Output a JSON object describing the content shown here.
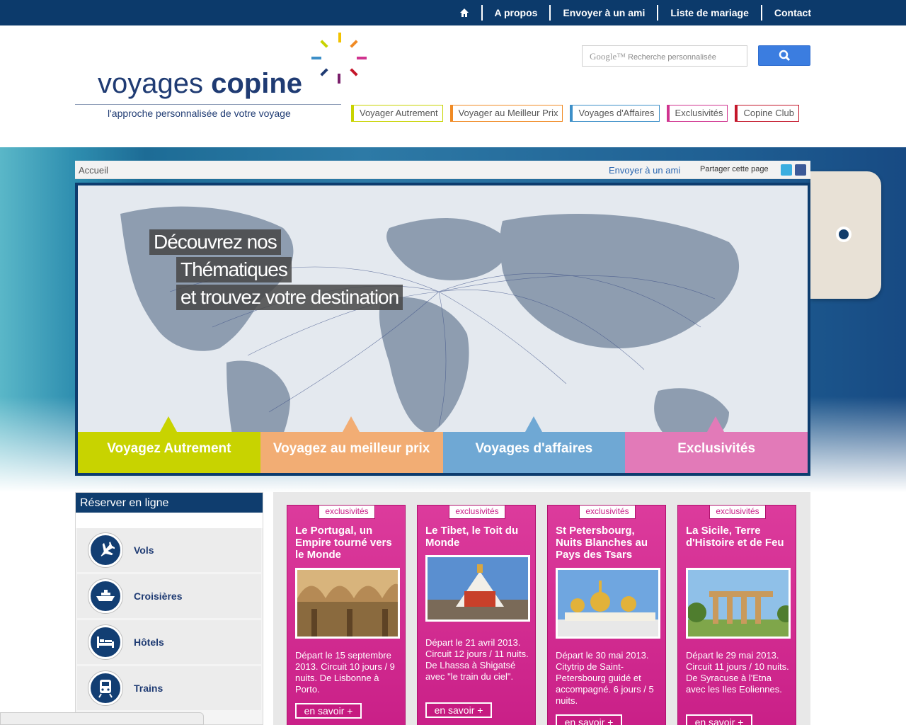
{
  "topnav": {
    "items": [
      "A propos",
      "Envoyer à un ami",
      "Liste de mariage",
      "Contact"
    ]
  },
  "logo": {
    "word1": "voyages",
    "word2": "copine",
    "tagline": "l'approche personnalisée de votre voyage"
  },
  "search": {
    "brand": "Google™",
    "placeholder": "Recherche personnalisée"
  },
  "themes": [
    {
      "label": "Voyager Autrement",
      "color": "#c8d300"
    },
    {
      "label": "Voyager au Meilleur Prix",
      "color": "#f08a24"
    },
    {
      "label": "Voyages d'Affaires",
      "color": "#3c8fc8"
    },
    {
      "label": "Exclusivités",
      "color": "#d0338f"
    },
    {
      "label": "Copine Club",
      "color": "#c4162a"
    }
  ],
  "crumbbar": {
    "crumb": "Accueil",
    "send": "Envoyer à un ami",
    "share": "Partager cette page"
  },
  "hero": {
    "line1": "Découvrez nos",
    "line2": "Thématiques",
    "line3": "et trouvez votre destination",
    "tabs": [
      {
        "label": "Voyagez Autrement",
        "color": "#c8d300"
      },
      {
        "label": "Voyagez au meilleur prix",
        "color": "#f2ad74"
      },
      {
        "label": "Voyages d'affaires",
        "color": "#6fa8d4"
      },
      {
        "label": "Exclusivités",
        "color": "#e27ab8"
      }
    ]
  },
  "booking": {
    "title": "Réserver en ligne",
    "items": [
      "Vols",
      "Croisières",
      "Hôtels",
      "Trains"
    ]
  },
  "offers": [
    {
      "tag": "exclusivités",
      "title": "Le Portugal, un Empire tourné vers le Monde",
      "text": "Départ le 15 septembre 2013. Circuit 10 jours / 9 nuits. De Lisbonne à Porto.",
      "button": "en savoir +"
    },
    {
      "tag": "exclusivités",
      "title": "Le Tibet, le Toit du Monde",
      "text": "Départ le 21 avril 2013. Circuit 12 jours / 11 nuits. De Lhassa à Shigatsé avec \"le train du ciel\".",
      "button": "en savoir +"
    },
    {
      "tag": "exclusivités",
      "title": "St Petersbourg, Nuits Blanches au Pays des Tsars",
      "text": "Départ le 30 mai 2013. Citytrip de Saint-Petersbourg guidé et accompagné. 6 jours / 5 nuits.",
      "button": "en savoir +"
    },
    {
      "tag": "exclusivités",
      "title": "La Sicile, Terre d'Histoire et de Feu",
      "text": "Départ le 29 mai 2013. Circuit 11 jours / 10 nuits. De Syracuse à l'Etna avec les Iles Eoliennes.",
      "button": "en savoir +"
    }
  ]
}
